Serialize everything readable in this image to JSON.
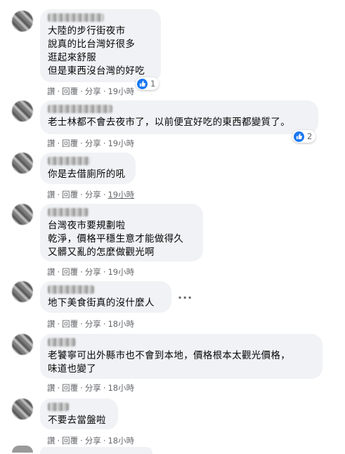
{
  "ui": {
    "like": "讚",
    "reply": "回覆",
    "share": "分享",
    "dot": "·"
  },
  "comments": [
    {
      "text": "大陸的步行街夜市\n說真的比台灣好很多\n逛起來舒服\n但是東西沒台灣的好吃",
      "time": "19小時",
      "reactions": "1"
    },
    {
      "text": "老士林都不會去夜市了，以前便宜好吃的東西都變質了。",
      "time": "19小時",
      "reactions": "2"
    },
    {
      "text": "你是去借廁所的吼",
      "time": "19小時",
      "reactions": ""
    },
    {
      "text": "台灣夜市要規劃啦\n乾淨，價格平穩生意才能做得久\n又髒又亂的怎麼做觀光啊",
      "time": "19小時",
      "reactions": ""
    },
    {
      "text": "地下美食街真的沒什麼人",
      "time": "18小時",
      "reactions": ""
    },
    {
      "text": "老饕寧可出外縣市也不會到本地，價格根本太觀光價格，\n味道也變了",
      "time": "18小時",
      "reactions": ""
    },
    {
      "text": "不要去當盤啦",
      "time": "18小時",
      "reactions": ""
    }
  ]
}
